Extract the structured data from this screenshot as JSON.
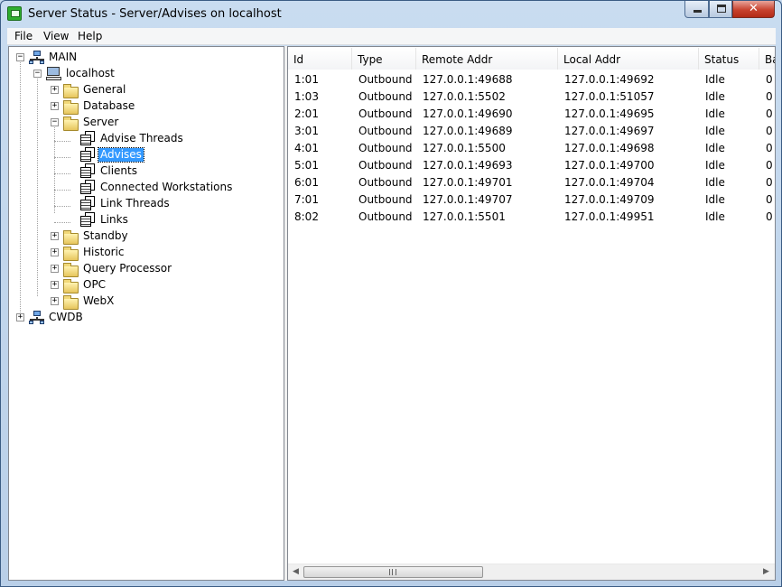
{
  "window": {
    "title": "Server Status - Server/Advises on localhost",
    "close_glyph": "✕"
  },
  "menu": [
    "File",
    "View",
    "Help"
  ],
  "tree": [
    {
      "label": "MAIN",
      "icon": "network-icon",
      "expander": "−"
    },
    {
      "label": "localhost",
      "icon": "computer-icon",
      "expander": "−"
    },
    {
      "label": "General",
      "icon": "folder-icon",
      "expander": "+"
    },
    {
      "label": "Database",
      "icon": "folder-icon",
      "expander": "+"
    },
    {
      "label": "Server",
      "icon": "folder-icon",
      "expander": "−"
    },
    {
      "label": "Advise Threads",
      "icon": "document-icon"
    },
    {
      "label": "Advises",
      "icon": "document-icon",
      "selected": true
    },
    {
      "label": "Clients",
      "icon": "document-icon"
    },
    {
      "label": "Connected Workstations",
      "icon": "document-icon"
    },
    {
      "label": "Link Threads",
      "icon": "document-icon"
    },
    {
      "label": "Links",
      "icon": "document-icon"
    },
    {
      "label": "Standby",
      "icon": "folder-icon",
      "expander": "+"
    },
    {
      "label": "Historic",
      "icon": "folder-icon",
      "expander": "+"
    },
    {
      "label": "Query Processor",
      "icon": "folder-icon",
      "expander": "+"
    },
    {
      "label": "OPC",
      "icon": "folder-icon",
      "expander": "+"
    },
    {
      "label": "WebX",
      "icon": "folder-icon",
      "expander": "+"
    },
    {
      "label": "CWDB",
      "icon": "network-icon",
      "expander": "+"
    }
  ],
  "list": {
    "columns": [
      "Id",
      "Type",
      "Remote Addr",
      "Local Addr",
      "Status",
      "Ba"
    ],
    "rows": [
      [
        "1:01",
        "Outbound",
        "127.0.0.1:49688",
        "127.0.0.1:49692",
        "Idle",
        "0"
      ],
      [
        "1:03",
        "Outbound",
        "127.0.0.1:5502",
        "127.0.0.1:51057",
        "Idle",
        "0"
      ],
      [
        "2:01",
        "Outbound",
        "127.0.0.1:49690",
        "127.0.0.1:49695",
        "Idle",
        "0"
      ],
      [
        "3:01",
        "Outbound",
        "127.0.0.1:49689",
        "127.0.0.1:49697",
        "Idle",
        "0"
      ],
      [
        "4:01",
        "Outbound",
        "127.0.0.1:5500",
        "127.0.0.1:49698",
        "Idle",
        "0"
      ],
      [
        "5:01",
        "Outbound",
        "127.0.0.1:49693",
        "127.0.0.1:49700",
        "Idle",
        "0"
      ],
      [
        "6:01",
        "Outbound",
        "127.0.0.1:49701",
        "127.0.0.1:49704",
        "Idle",
        "0"
      ],
      [
        "7:01",
        "Outbound",
        "127.0.0.1:49707",
        "127.0.0.1:49709",
        "Idle",
        "0"
      ],
      [
        "8:02",
        "Outbound",
        "127.0.0.1:5501",
        "127.0.0.1:49951",
        "Idle",
        "0"
      ]
    ]
  },
  "scrollbar": {
    "left_arrow": "◀",
    "right_arrow": "▶"
  },
  "colors": {
    "selection": "#3399ff",
    "frame": "#b9cfe8"
  }
}
